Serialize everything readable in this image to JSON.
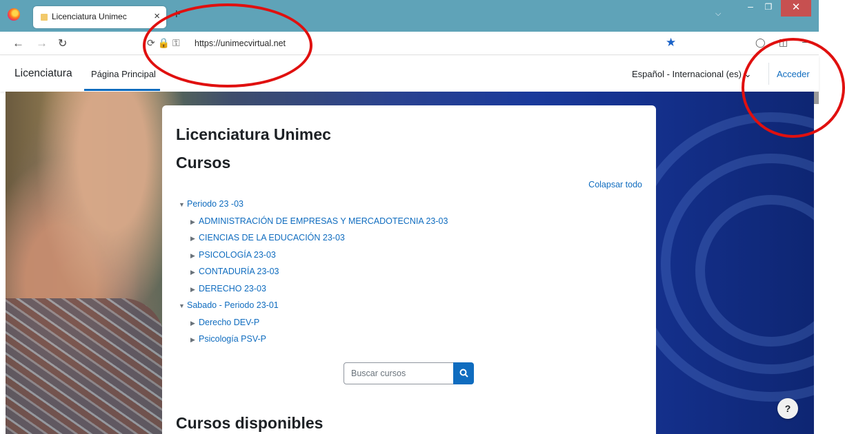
{
  "browser": {
    "tab_title": "Licenciatura Unimec",
    "tab_close": "×",
    "new_tab": "+",
    "url": "https://unimecvirtual.net",
    "url_icons": "⟳ 🔒 ⚿"
  },
  "header": {
    "brand": "Licenciatura",
    "nav_home": "Página Principal",
    "language": "Español - Internacional (es) ⌄",
    "login": "Acceder"
  },
  "card": {
    "site_title": "Licenciatura Unimec",
    "section_title": "Cursos",
    "collapse_all": "Colapsar todo",
    "categories": [
      {
        "label": "Periodo 23 -03",
        "level": 0,
        "expanded": true
      },
      {
        "label": "ADMINISTRACIÓN DE EMPRESAS Y MERCADOTECNIA 23-03",
        "level": 1,
        "expanded": false
      },
      {
        "label": "CIENCIAS DE LA EDUCACIÓN 23-03",
        "level": 1,
        "expanded": false
      },
      {
        "label": "PSICOLOGÍA 23-03",
        "level": 1,
        "expanded": false
      },
      {
        "label": "CONTADURÍA 23-03",
        "level": 1,
        "expanded": false
      },
      {
        "label": "DERECHO 23-03",
        "level": 1,
        "expanded": false
      },
      {
        "label": "Sabado - Periodo 23-01",
        "level": 0,
        "expanded": true
      },
      {
        "label": "Derecho DEV-P",
        "level": 1,
        "expanded": false
      },
      {
        "label": "Psicología PSV-P",
        "level": 1,
        "expanded": false
      }
    ],
    "search_placeholder": "Buscar cursos",
    "available_title": "Cursos disponibles"
  },
  "help": "?",
  "colors": {
    "accent": "#0f6cbf",
    "titlebar": "#5fa3b8",
    "annotation": "#e0100f"
  }
}
